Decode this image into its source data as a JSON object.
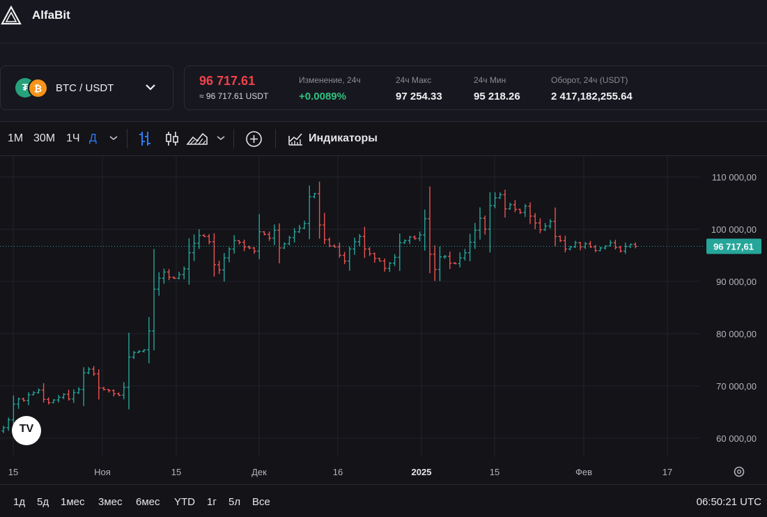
{
  "app": {
    "name": "AlfaBit"
  },
  "pair": {
    "label": "BTC / USDT",
    "base_icon": "bitcoin-icon",
    "quote_icon": "tether-icon"
  },
  "ticker": {
    "price": "96 717.61",
    "price_usdt": "≈ 96 717.61 USDT",
    "change_label": "Изменение, 24ч",
    "change_value": "+0.0089%",
    "high_label": "24ч Макс",
    "high_value": "97 254.33",
    "low_label": "24ч Мин",
    "low_value": "95 218.26",
    "volume_label": "Оборот, 24ч (USDT)",
    "volume_value": "2 417,182,255.64"
  },
  "toolbar": {
    "timeframes": [
      "1М",
      "30М",
      "1Ч",
      "Д"
    ],
    "active_timeframe": "Д",
    "indicators_label": "Индикаторы"
  },
  "bottom": {
    "ranges": [
      "1д",
      "5д",
      "1мес",
      "3мес",
      "6мес",
      "YTD",
      "1г",
      "5л",
      "Все"
    ],
    "clock": "06:50:21 UTC"
  },
  "colors": {
    "up": "#26a69a",
    "down": "#ef5350",
    "accent": "#2d7cf6",
    "price_tag": "#26a69a"
  },
  "chart_data": {
    "type": "candlestick",
    "y_ticks": [
      "110 000,00",
      "100 000,00",
      "90 000,00",
      "80 000,00",
      "70 000,00",
      "60 000,00"
    ],
    "y_tick_values": [
      110000,
      100000,
      90000,
      80000,
      70000,
      60000
    ],
    "ylim": [
      55300,
      114000
    ],
    "x_ticks": [
      "15",
      "Ноя",
      "15",
      "Дек",
      "16",
      "2025",
      "15",
      "Фев",
      "17"
    ],
    "last_price_label": "96 717,61",
    "last_price": 96717.61,
    "closes": [
      62000,
      63500,
      66500,
      67500,
      67200,
      68300,
      68700,
      69200,
      67400,
      66800,
      67300,
      67800,
      68400,
      67500,
      68700,
      69300,
      72500,
      73200,
      72300,
      69600,
      69300,
      69100,
      68500,
      68200,
      69700,
      75500,
      76400,
      76600,
      76900,
      80500,
      88500,
      90600,
      91800,
      90800,
      90600,
      91300,
      92400,
      95500,
      97300,
      98800,
      98600,
      97600,
      93200,
      92200,
      94500,
      96200,
      97800,
      97500,
      96600,
      96400,
      95800,
      99500,
      99000,
      98300,
      99800,
      96400,
      97200,
      98400,
      99500,
      100200,
      101100,
      106200,
      106800,
      100800,
      98000,
      96800,
      96600,
      95000,
      93900,
      96200,
      97600,
      98600,
      96200,
      95300,
      94400,
      93900,
      92500,
      93500,
      94600,
      97400,
      97800,
      98500,
      98200,
      98900,
      102000,
      95200,
      92300,
      94700,
      94800,
      93500,
      93400,
      94500,
      95500,
      97500,
      99800,
      102100,
      100000,
      104500,
      106000,
      106600,
      103900,
      104700,
      103800,
      103200,
      104400,
      102500,
      101200,
      99900,
      100600,
      101500,
      98600,
      97800,
      96200,
      96600,
      97400,
      96600,
      97200,
      96600,
      95900,
      96400,
      96800,
      97400,
      96500,
      95800,
      96700,
      97100,
      96717
    ]
  }
}
